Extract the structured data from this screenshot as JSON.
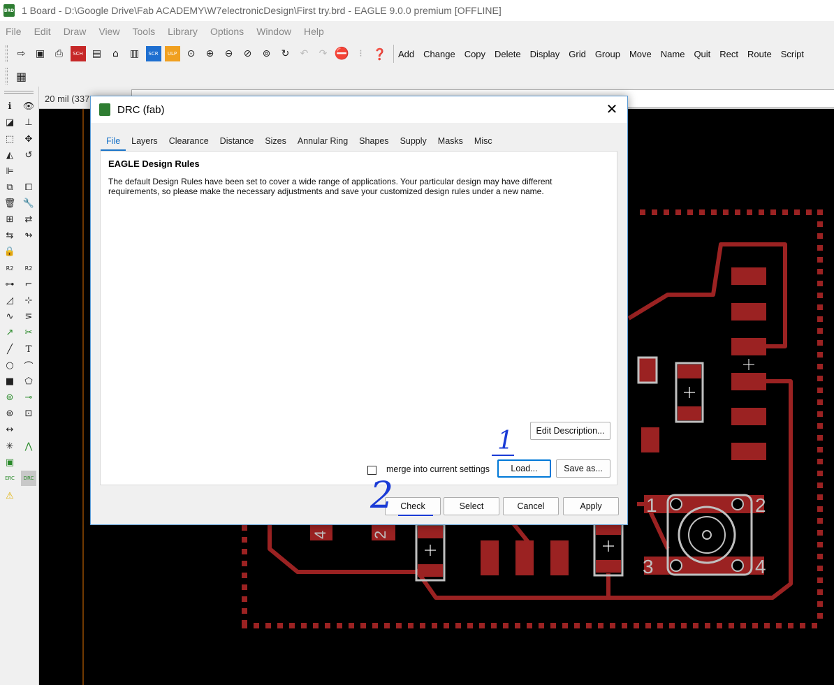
{
  "window": {
    "title": "1 Board - D:\\Google Drive\\Fab ACADEMY\\W7electronicDesign\\First try.brd - EAGLE 9.0.0 premium [OFFLINE]",
    "app_icon": "eagle-brd-icon"
  },
  "menu": [
    "File",
    "Edit",
    "Draw",
    "View",
    "Tools",
    "Library",
    "Options",
    "Window",
    "Help"
  ],
  "toolbar": {
    "commands": [
      "Add",
      "Change",
      "Copy",
      "Delete",
      "Display",
      "Grid",
      "Group",
      "Move",
      "Name",
      "Quit",
      "Rect",
      "Route",
      "Script"
    ]
  },
  "coord": {
    "text": "20 mil (337"
  },
  "dialog": {
    "title": "DRC (fab)",
    "tabs": [
      "File",
      "Layers",
      "Clearance",
      "Distance",
      "Sizes",
      "Annular Ring",
      "Shapes",
      "Supply",
      "Masks",
      "Misc"
    ],
    "active_tab": "File",
    "heading": "EAGLE Design Rules",
    "description": "The default Design Rules have been set to cover a wide range of applications. Your particular design may have different requirements, so please make the necessary adjustments and save your customized design rules under a new name.",
    "edit_description_label": "Edit Description...",
    "merge_label": "merge into current settings",
    "merge_checked": false,
    "load_label": "Load...",
    "save_as_label": "Save as...",
    "check_label": "Check",
    "select_label": "Select",
    "cancel_label": "Cancel",
    "apply_label": "Apply"
  },
  "annotations": {
    "one": "1",
    "two": "2"
  },
  "board": {
    "pad_labels": [
      "1",
      "2",
      "3",
      "4"
    ],
    "part_labels": [
      "4",
      "2"
    ],
    "colors": {
      "background": "#000000",
      "copper": "#9b2222",
      "outline": "#c0c0c0"
    }
  }
}
